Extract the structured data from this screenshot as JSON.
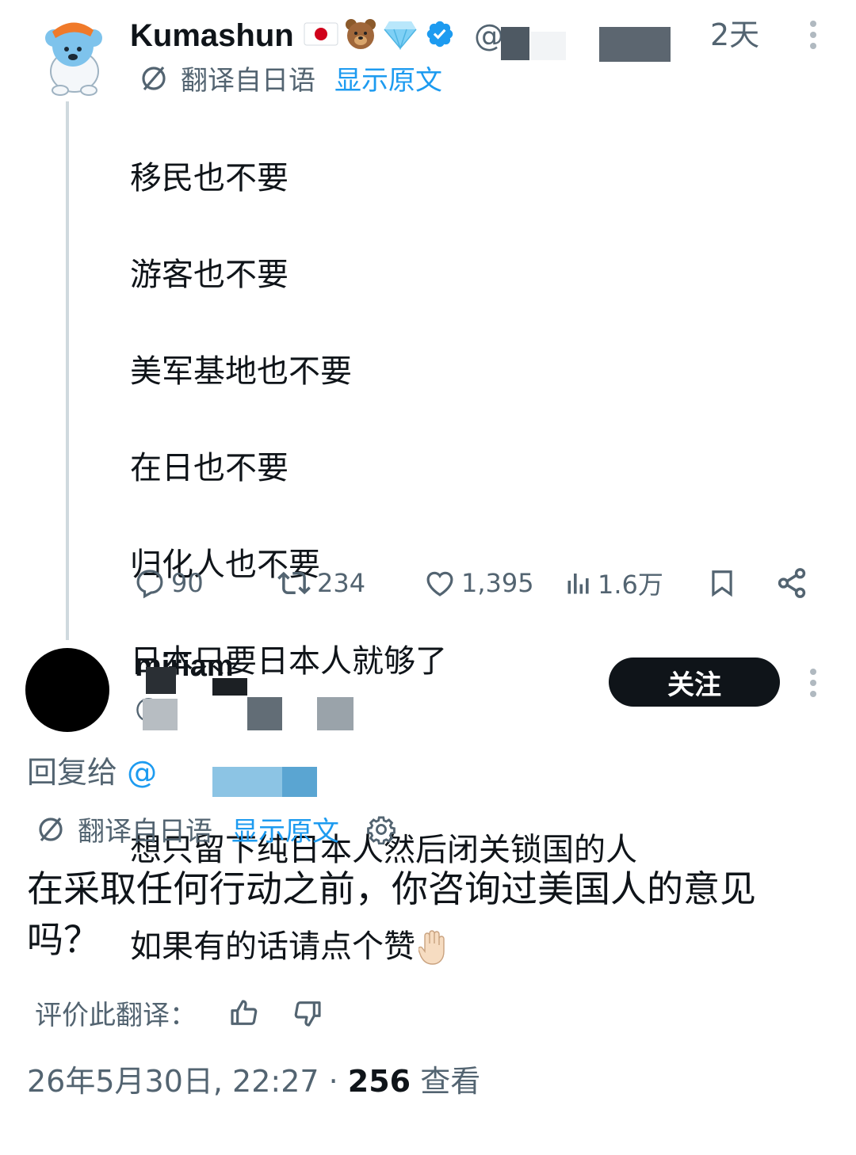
{
  "colors": {
    "text": "#0f1419",
    "secondary": "#536471",
    "link": "#1d9bf0",
    "thread_line": "#cfd9de"
  },
  "tweet": {
    "author_name": "Kumashun",
    "badges": [
      "jp-flag-icon",
      "bear-face-icon",
      "gem-icon",
      "verified-badge-icon"
    ],
    "handle_prefix": "@",
    "time": "2天",
    "translated_label": "翻译自日语",
    "show_original": "显示原文",
    "lines": [
      "移民也不要",
      "游客也不要",
      "美军基地也不要",
      "在日也不要",
      "归化人也不要",
      "日本只要日本人就够了",
      "",
      "想只留下纯日本人然后闭关锁国的人",
      "如果有的话请点个赞"
    ],
    "stats": {
      "replies": "90",
      "retweets": "234",
      "likes": "1,395",
      "views": "1.6万"
    }
  },
  "reply": {
    "author_name": "miriam",
    "handle_prefix": "@",
    "follow_label": "关注",
    "reply_to_label": "回复给",
    "reply_to_prefix": "@",
    "translated_label": "翻译自日语",
    "show_original": "显示原文",
    "text": "在采取任何行动之前，你咨询过美国人的意见吗？",
    "rate_label": "评价此翻译：",
    "date": "26年5月30日, 22:27 · ",
    "views_count": "256",
    "views_label": " 查看"
  }
}
